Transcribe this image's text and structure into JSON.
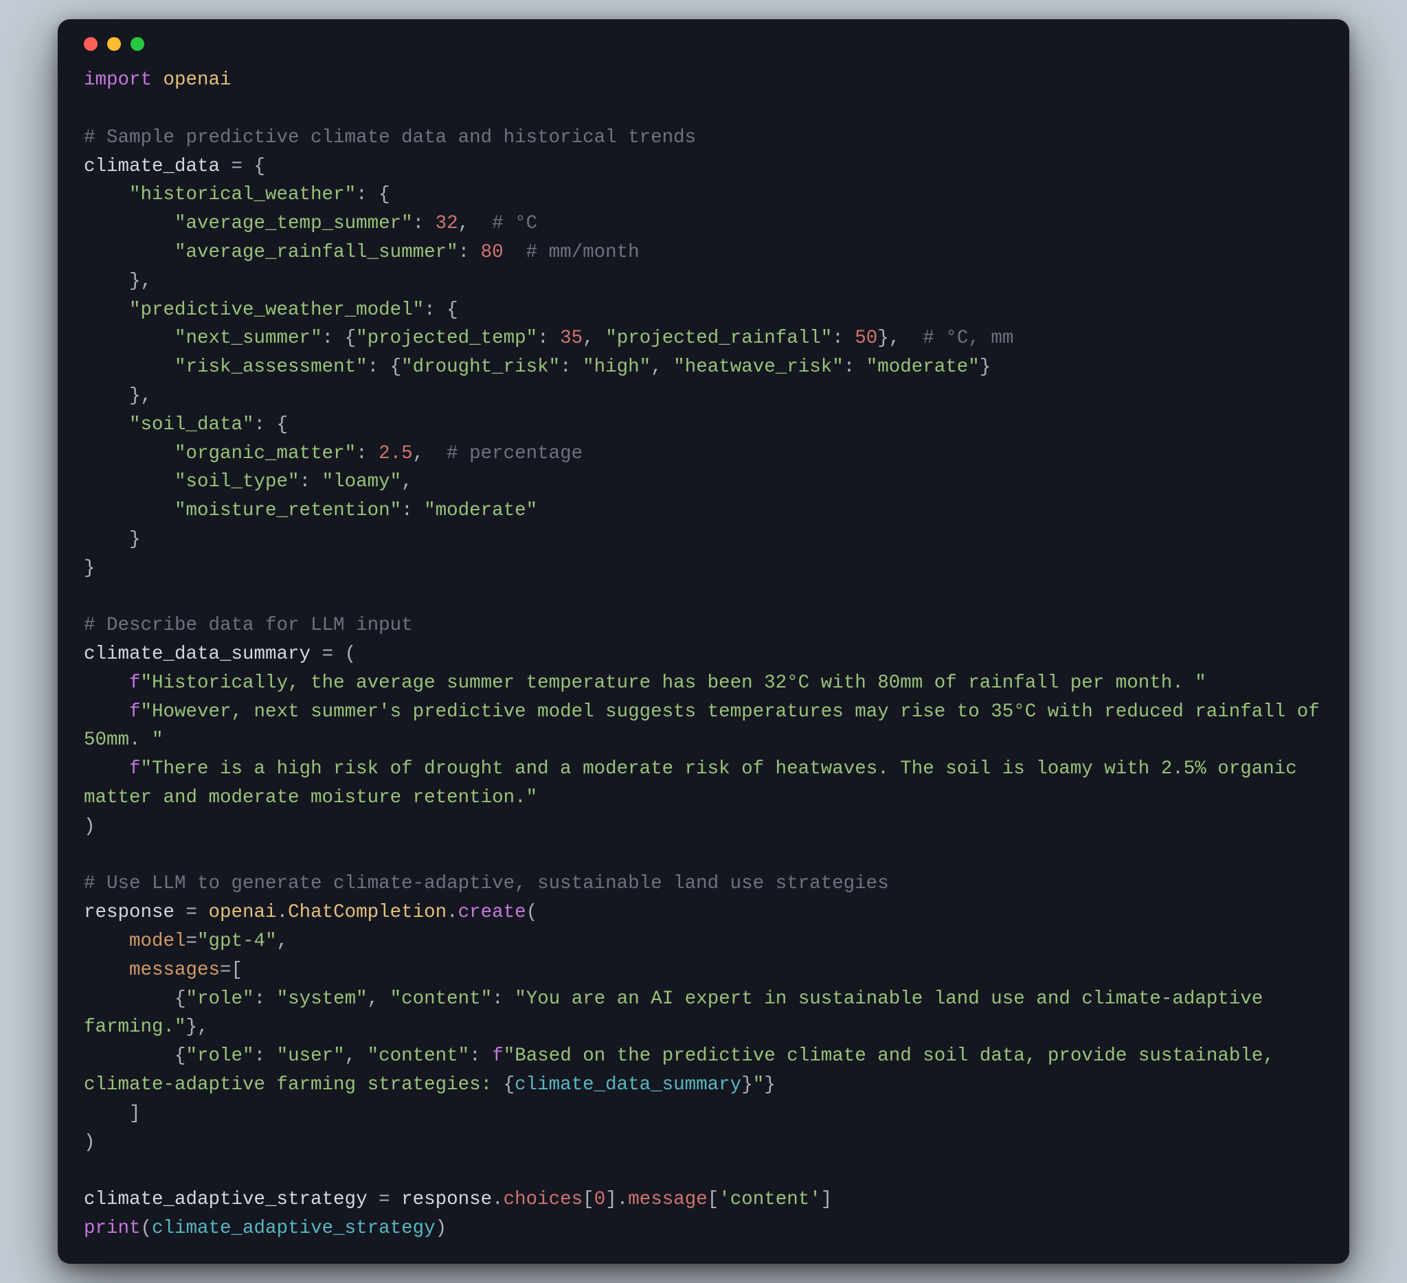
{
  "window": {
    "traffic_lights": [
      "close",
      "minimize",
      "zoom"
    ]
  },
  "code": {
    "language": "python",
    "tokens": [
      [
        [
          "kw",
          "import"
        ],
        [
          "sp",
          " "
        ],
        [
          "mod",
          "openai"
        ]
      ],
      [],
      [
        [
          "comment",
          "# Sample predictive climate data and historical trends"
        ]
      ],
      [
        [
          "var",
          "climate_data "
        ],
        [
          "punct",
          "= {"
        ]
      ],
      [
        [
          "sp",
          "    "
        ],
        [
          "str",
          "\"historical_weather\""
        ],
        [
          "punct",
          ": {"
        ]
      ],
      [
        [
          "sp",
          "        "
        ],
        [
          "str",
          "\"average_temp_summer\""
        ],
        [
          "punct",
          ": "
        ],
        [
          "num",
          "32"
        ],
        [
          "punct",
          ","
        ],
        [
          "sp",
          "  "
        ],
        [
          "comment",
          "# °C"
        ]
      ],
      [
        [
          "sp",
          "        "
        ],
        [
          "str",
          "\"average_rainfall_summer\""
        ],
        [
          "punct",
          ": "
        ],
        [
          "num",
          "80"
        ],
        [
          "sp",
          "  "
        ],
        [
          "comment",
          "# mm/month"
        ]
      ],
      [
        [
          "sp",
          "    "
        ],
        [
          "punct",
          "},"
        ]
      ],
      [
        [
          "sp",
          "    "
        ],
        [
          "str",
          "\"predictive_weather_model\""
        ],
        [
          "punct",
          ": {"
        ]
      ],
      [
        [
          "sp",
          "        "
        ],
        [
          "str",
          "\"next_summer\""
        ],
        [
          "punct",
          ": {"
        ],
        [
          "str",
          "\"projected_temp\""
        ],
        [
          "punct",
          ": "
        ],
        [
          "num",
          "35"
        ],
        [
          "punct",
          ", "
        ],
        [
          "str",
          "\"projected_rainfall\""
        ],
        [
          "punct",
          ": "
        ],
        [
          "num",
          "50"
        ],
        [
          "punct",
          "},"
        ],
        [
          "sp",
          "  "
        ],
        [
          "comment",
          "# °C, mm"
        ]
      ],
      [
        [
          "sp",
          "        "
        ],
        [
          "str",
          "\"risk_assessment\""
        ],
        [
          "punct",
          ": {"
        ],
        [
          "str",
          "\"drought_risk\""
        ],
        [
          "punct",
          ": "
        ],
        [
          "str",
          "\"high\""
        ],
        [
          "punct",
          ", "
        ],
        [
          "str",
          "\"heatwave_risk\""
        ],
        [
          "punct",
          ": "
        ],
        [
          "str",
          "\"moderate\""
        ],
        [
          "punct",
          "}"
        ]
      ],
      [
        [
          "sp",
          "    "
        ],
        [
          "punct",
          "},"
        ]
      ],
      [
        [
          "sp",
          "    "
        ],
        [
          "str",
          "\"soil_data\""
        ],
        [
          "punct",
          ": {"
        ]
      ],
      [
        [
          "sp",
          "        "
        ],
        [
          "str",
          "\"organic_matter\""
        ],
        [
          "punct",
          ": "
        ],
        [
          "num",
          "2.5"
        ],
        [
          "punct",
          ","
        ],
        [
          "sp",
          "  "
        ],
        [
          "comment",
          "# percentage"
        ]
      ],
      [
        [
          "sp",
          "        "
        ],
        [
          "str",
          "\"soil_type\""
        ],
        [
          "punct",
          ": "
        ],
        [
          "str",
          "\"loamy\""
        ],
        [
          "punct",
          ","
        ]
      ],
      [
        [
          "sp",
          "        "
        ],
        [
          "str",
          "\"moisture_retention\""
        ],
        [
          "punct",
          ": "
        ],
        [
          "str",
          "\"moderate\""
        ]
      ],
      [
        [
          "sp",
          "    "
        ],
        [
          "punct",
          "}"
        ]
      ],
      [
        [
          "punct",
          "}"
        ]
      ],
      [],
      [
        [
          "comment",
          "# Describe data for LLM input"
        ]
      ],
      [
        [
          "var",
          "climate_data_summary "
        ],
        [
          "punct",
          "= ("
        ]
      ],
      [
        [
          "sp",
          "    "
        ],
        [
          "fstr",
          "f"
        ],
        [
          "str",
          "\"Historically, the average summer temperature has been 32°C with 80mm of rainfall per month. \""
        ]
      ],
      [
        [
          "sp",
          "    "
        ],
        [
          "fstr",
          "f"
        ],
        [
          "str",
          "\"However, next summer's predictive model suggests temperatures may rise to 35°C with reduced rainfall of 50mm. \""
        ]
      ],
      [
        [
          "sp",
          "    "
        ],
        [
          "fstr",
          "f"
        ],
        [
          "str",
          "\"There is a high risk of drought and a moderate risk of heatwaves. The soil is loamy with 2.5% organic matter and moderate moisture retention.\""
        ]
      ],
      [
        [
          "punct",
          ")"
        ]
      ],
      [],
      [
        [
          "comment",
          "# Use LLM to generate climate-adaptive, sustainable land use strategies"
        ]
      ],
      [
        [
          "var",
          "response "
        ],
        [
          "punct",
          "= "
        ],
        [
          "mod",
          "openai"
        ],
        [
          "punct",
          "."
        ],
        [
          "mod",
          "ChatCompletion"
        ],
        [
          "punct",
          "."
        ],
        [
          "fn",
          "create"
        ],
        [
          "punct",
          "("
        ]
      ],
      [
        [
          "sp",
          "    "
        ],
        [
          "param",
          "model"
        ],
        [
          "punct",
          "="
        ],
        [
          "str",
          "\"gpt-4\""
        ],
        [
          "punct",
          ","
        ]
      ],
      [
        [
          "sp",
          "    "
        ],
        [
          "param",
          "messages"
        ],
        [
          "punct",
          "=["
        ]
      ],
      [
        [
          "sp",
          "        "
        ],
        [
          "punct",
          "{"
        ],
        [
          "str",
          "\"role\""
        ],
        [
          "punct",
          ": "
        ],
        [
          "str",
          "\"system\""
        ],
        [
          "punct",
          ", "
        ],
        [
          "str",
          "\"content\""
        ],
        [
          "punct",
          ": "
        ],
        [
          "str",
          "\"You are an AI expert in sustainable land use and climate-adaptive farming.\""
        ],
        [
          "punct",
          "},"
        ]
      ],
      [
        [
          "sp",
          "        "
        ],
        [
          "punct",
          "{"
        ],
        [
          "str",
          "\"role\""
        ],
        [
          "punct",
          ": "
        ],
        [
          "str",
          "\"user\""
        ],
        [
          "punct",
          ", "
        ],
        [
          "str",
          "\"content\""
        ],
        [
          "punct",
          ": "
        ],
        [
          "fstr",
          "f"
        ],
        [
          "str",
          "\"Based on the predictive climate and soil data, provide sustainable, climate-adaptive farming strategies: "
        ],
        [
          "punct",
          "{"
        ],
        [
          "ident",
          "climate_data_summary"
        ],
        [
          "punct",
          "}"
        ],
        [
          "str",
          "\""
        ],
        [
          "punct",
          "}"
        ]
      ],
      [
        [
          "sp",
          "    "
        ],
        [
          "punct",
          "]"
        ]
      ],
      [
        [
          "punct",
          ")"
        ]
      ],
      [],
      [
        [
          "var",
          "climate_adaptive_strategy "
        ],
        [
          "punct",
          "= "
        ],
        [
          "var",
          "response"
        ],
        [
          "punct",
          "."
        ],
        [
          "attr",
          "choices"
        ],
        [
          "punct",
          "["
        ],
        [
          "num",
          "0"
        ],
        [
          "punct",
          "]."
        ],
        [
          "attr",
          "message"
        ],
        [
          "punct",
          "["
        ],
        [
          "str",
          "'content'"
        ],
        [
          "punct",
          "]"
        ]
      ],
      [
        [
          "fn",
          "print"
        ],
        [
          "punct",
          "("
        ],
        [
          "ident",
          "climate_adaptive_strategy"
        ],
        [
          "punct",
          ")"
        ]
      ]
    ]
  }
}
